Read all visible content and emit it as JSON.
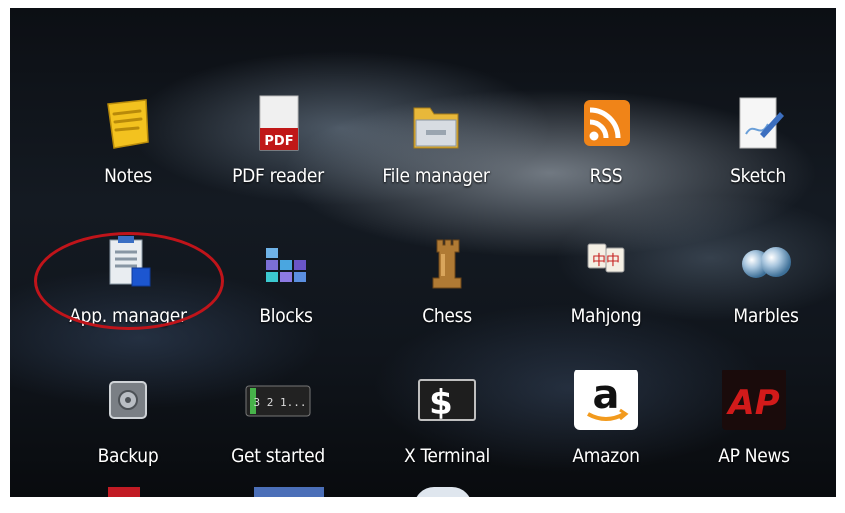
{
  "apps": [
    {
      "label": "Notes",
      "icon": "notes-icon"
    },
    {
      "label": "PDF reader",
      "icon": "pdf-icon",
      "icon_text": "PDF"
    },
    {
      "label": "File manager",
      "icon": "folder-icon"
    },
    {
      "label": "RSS",
      "icon": "rss-icon"
    },
    {
      "label": "Sketch",
      "icon": "sketch-icon"
    },
    {
      "label": "App. manager",
      "icon": "app-manager-icon"
    },
    {
      "label": "Blocks",
      "icon": "blocks-icon"
    },
    {
      "label": "Chess",
      "icon": "chess-rook-icon"
    },
    {
      "label": "Mahjong",
      "icon": "mahjong-icon",
      "icon_text": "中中"
    },
    {
      "label": "Marbles",
      "icon": "marbles-icon"
    },
    {
      "label": "Backup",
      "icon": "backup-icon"
    },
    {
      "label": "Get started",
      "icon": "get-started-icon",
      "icon_text": "3 2 1..."
    },
    {
      "label": "X Terminal",
      "icon": "terminal-icon",
      "icon_text": "$"
    },
    {
      "label": "Amazon",
      "icon": "amazon-icon",
      "icon_text": "a"
    },
    {
      "label": "AP News",
      "icon": "ap-news-icon",
      "icon_text": "AP"
    }
  ],
  "highlight_color": "#c0141a"
}
